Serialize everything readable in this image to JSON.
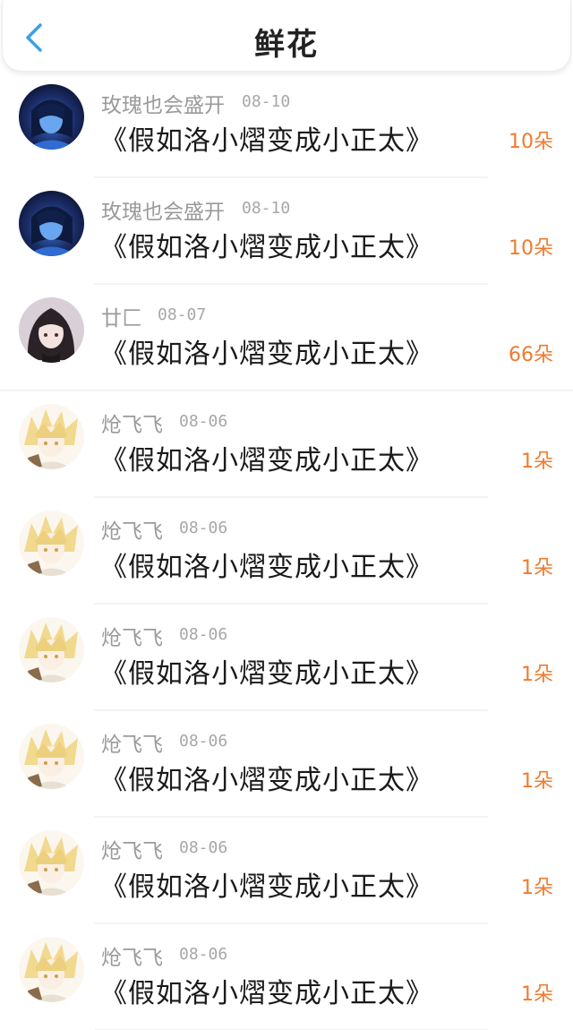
{
  "header": {
    "title": "鲜花",
    "back_icon": "chevron-left-icon",
    "accent_color": "#3aa0e8"
  },
  "colors": {
    "amount": "#f07a2e",
    "username": "#9a9a9a",
    "title": "#1a1a1a"
  },
  "items": [
    {
      "user": "玫瑰也会盛开",
      "date": "08-10",
      "book": "《假如洛小熠变成小正太》",
      "amount": "10朵",
      "avatar": "dark-blue-avatar"
    },
    {
      "user": "玫瑰也会盛开",
      "date": "08-10",
      "book": "《假如洛小熠变成小正太》",
      "amount": "10朵",
      "avatar": "dark-blue-avatar"
    },
    {
      "user": "廿匚",
      "date": "08-07",
      "book": "《假如洛小熠变成小正太》",
      "amount": "66朵",
      "avatar": "dark-hair-avatar"
    },
    {
      "user": "炝飞飞",
      "date": "08-06",
      "book": "《假如洛小熠变成小正太》",
      "amount": "1朵",
      "avatar": "blonde-avatar"
    },
    {
      "user": "炝飞飞",
      "date": "08-06",
      "book": "《假如洛小熠变成小正太》",
      "amount": "1朵",
      "avatar": "blonde-avatar"
    },
    {
      "user": "炝飞飞",
      "date": "08-06",
      "book": "《假如洛小熠变成小正太》",
      "amount": "1朵",
      "avatar": "blonde-avatar"
    },
    {
      "user": "炝飞飞",
      "date": "08-06",
      "book": "《假如洛小熠变成小正太》",
      "amount": "1朵",
      "avatar": "blonde-avatar"
    },
    {
      "user": "炝飞飞",
      "date": "08-06",
      "book": "《假如洛小熠变成小正太》",
      "amount": "1朵",
      "avatar": "blonde-avatar"
    },
    {
      "user": "炝飞飞",
      "date": "08-06",
      "book": "《假如洛小熠变成小正太》",
      "amount": "1朵",
      "avatar": "blonde-avatar"
    }
  ]
}
